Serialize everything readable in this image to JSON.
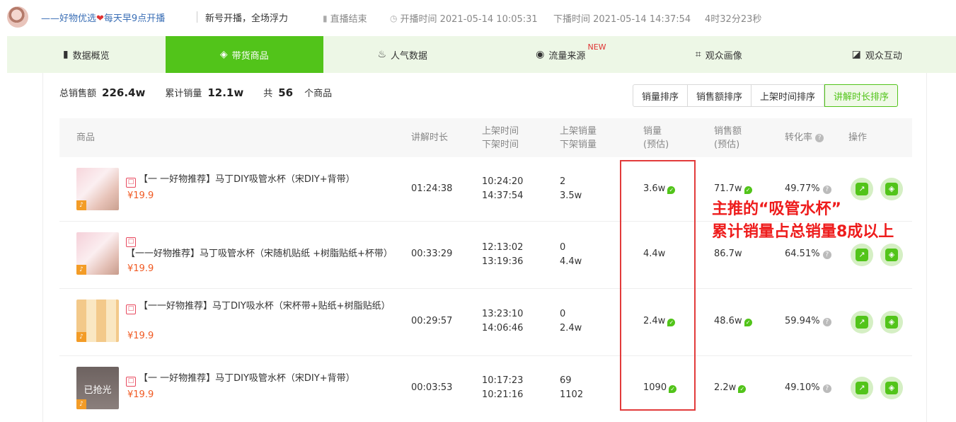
{
  "header": {
    "streamer_prefix": "——好物优选",
    "heart": "❤",
    "streamer_suffix": "每天早9点开播",
    "slogan": "新号开播，全场浮力",
    "status": "直播结束",
    "start_time": "开播时间 2021-05-14 10:05:31",
    "end_time": "下播时间 2021-05-14 14:37:54",
    "duration": "4时32分23秒"
  },
  "tabs": [
    {
      "label": "数据概览",
      "icon": "bar-chart-icon"
    },
    {
      "label": "带货商品",
      "icon": "shopping-bag-icon",
      "active": true
    },
    {
      "label": "人气数据",
      "icon": "flame-icon"
    },
    {
      "label": "流量来源",
      "icon": "pulse-icon",
      "badge": "NEW"
    },
    {
      "label": "观众画像",
      "icon": "face-scan-icon"
    },
    {
      "label": "观众互动",
      "icon": "chat-icon"
    }
  ],
  "summary": {
    "total_sales_label": "总销售额",
    "total_sales": "226.4w",
    "total_volume_label": "累计销量",
    "total_volume": "12.1w",
    "count_prefix": "共",
    "count": "56",
    "count_suffix": "个商品"
  },
  "sort_buttons": [
    "销量排序",
    "销售额排序",
    "上架时间排序",
    "讲解时长排序"
  ],
  "active_sort": "讲解时长排序",
  "columns": {
    "product": "商品",
    "explain": "讲解时长",
    "time_on": "上架时间",
    "time_off": "下架时间",
    "vol_on": "上架销量",
    "vol_off": "下架销量",
    "sales_1": "销量",
    "sales_2": "(预估)",
    "revenue_1": "销售额",
    "revenue_2": "(预估)",
    "conversion": "转化率",
    "ops": "操作"
  },
  "rows": [
    {
      "thumb_label": "",
      "name": "【一 一好物推荐】马丁DIY吸管水杯（宋DIY+背带）",
      "price": "¥19.9",
      "explain": "01:24:38",
      "time_on": "10:24:20",
      "time_off": "14:37:54",
      "vol_on": "2",
      "vol_off": "3.5w",
      "sales": "3.6w",
      "revenue": "71.7w",
      "conversion": "49.77%"
    },
    {
      "thumb_label": "",
      "name": "【一一好物推荐】马丁吸管水杯（宋随机贴纸 +树脂贴纸+杯带）",
      "price": "¥19.9",
      "explain": "00:33:29",
      "time_on": "12:13:02",
      "time_off": "13:19:36",
      "vol_on": "0",
      "vol_off": "4.4w",
      "sales": "4.4w",
      "revenue": "86.7w",
      "conversion": "64.51%"
    },
    {
      "thumb_label": "",
      "name": "【一一好物推荐】马丁DIY吸水杯（宋杯带+贴纸+树脂贴纸）",
      "price": "¥19.9",
      "explain": "00:29:57",
      "time_on": "13:23:10",
      "time_off": "14:06:46",
      "vol_on": "0",
      "vol_off": "2.4w",
      "sales": "2.4w",
      "revenue": "48.6w",
      "conversion": "59.94%"
    },
    {
      "thumb_label": "已抢光",
      "name": "【一 一好物推荐】马丁DIY吸管水杯（宋DIY+背带）",
      "price": "¥19.9",
      "explain": "00:03:53",
      "time_on": "10:17:23",
      "time_off": "10:21:16",
      "vol_on": "69",
      "vol_off": "1102",
      "sales": "1090",
      "revenue": "2.2w",
      "conversion": "49.10%"
    }
  ],
  "annotation": {
    "line1": "主推的“吸管水杯”",
    "line2": "累计销量占总销量8成以上",
    "color": "#ee1c1c"
  },
  "colors": {
    "accent": "#52c41a",
    "price": "#f05a23",
    "link": "#3b6fb6"
  }
}
